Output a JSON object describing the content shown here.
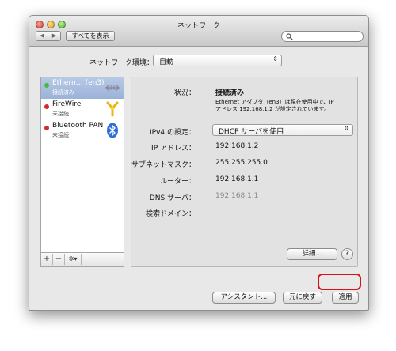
{
  "window": {
    "title": "ネットワーク"
  },
  "toolbar": {
    "show_all_label": "すべてを表示",
    "back_glyph": "◀",
    "forward_glyph": "▶",
    "search_placeholder": ""
  },
  "location": {
    "label": "ネットワーク環境：",
    "value": "自動",
    "arrows": "⇕"
  },
  "services": [
    {
      "name": "Ethern… (en3)",
      "status": "接続済み",
      "status_color": "#3fbf3a",
      "icon": "ethernet-icon",
      "selected": true
    },
    {
      "name": "FireWire",
      "status": "未接続",
      "status_color": "#d42a2a",
      "icon": "firewire-icon",
      "selected": false
    },
    {
      "name": "Bluetooth PAN",
      "status": "未接続",
      "status_color": "#d42a2a",
      "icon": "bluetooth-icon",
      "selected": false
    }
  ],
  "sidebar_buttons": {
    "add": "+",
    "remove": "−",
    "gear": "✲▾"
  },
  "detail": {
    "status_label": "状況：",
    "status_value": "接続済み",
    "status_desc_1": "Ethernet アダプタ（en3）は現在使用中で、IP",
    "status_desc_2": "アドレス 192.168.1.2 が設定されています。",
    "ipv4_label": "IPv4 の設定：",
    "ipv4_value": "DHCP サーバを使用",
    "ip_label": "IP アドレス：",
    "ip_value": "192.168.1.2",
    "subnet_label": "サブネットマスク：",
    "subnet_value": "255.255.255.0",
    "router_label": "ルーター：",
    "router_value": "192.168.1.1",
    "dns_label": "DNS サーバ：",
    "dns_value": "192.168.1.1",
    "search_domain_label": "検索ドメイン：",
    "advanced_label": "詳細...",
    "help_label": "?"
  },
  "footer": {
    "assistant_label": "アシスタント...",
    "revert_label": "元に戻す",
    "apply_label": "適用"
  },
  "colors": {
    "selection": "#9bb2d9",
    "highlight_ring": "#d8121d"
  }
}
